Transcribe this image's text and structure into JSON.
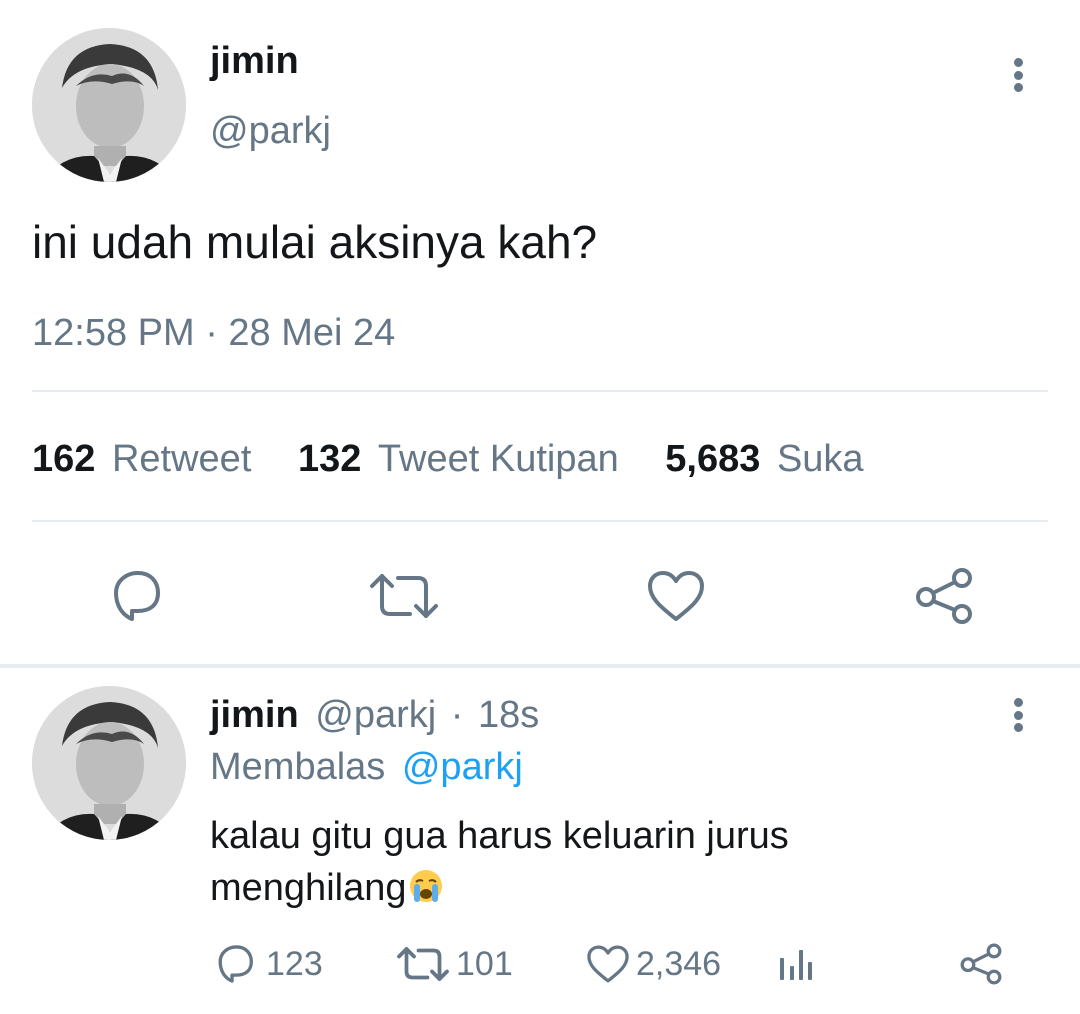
{
  "tweet": {
    "display_name": "jimin",
    "handle": "@parkj",
    "text": "ini udah mulai aksinya kah?",
    "timestamp": "12:58 PM · 28 Mei 24",
    "stats": {
      "retweets": {
        "count": "162",
        "label": "Retweet"
      },
      "quotes": {
        "count": "132",
        "label": "Tweet Kutipan"
      },
      "likes": {
        "count": "5,683",
        "label": "Suka"
      }
    },
    "icons": [
      "reply-icon",
      "retweet-icon",
      "like-icon",
      "share-icon",
      "more-icon"
    ]
  },
  "reply": {
    "display_name": "jimin",
    "handle": "@parkj",
    "separator": "·",
    "time": "18s",
    "replying_label": "Membalas",
    "replying_to": "@parkj",
    "text_line1": "kalau gitu gua harus keluarin jurus",
    "text_line2": "menghilang",
    "emoji": "loudly-crying-face",
    "actions": {
      "replies": "123",
      "retweets": "101",
      "likes": "2,346"
    }
  },
  "colors": {
    "text": "#14171a",
    "muted": "#657786",
    "link": "#1da1f2",
    "divider": "#e6ecf0"
  }
}
